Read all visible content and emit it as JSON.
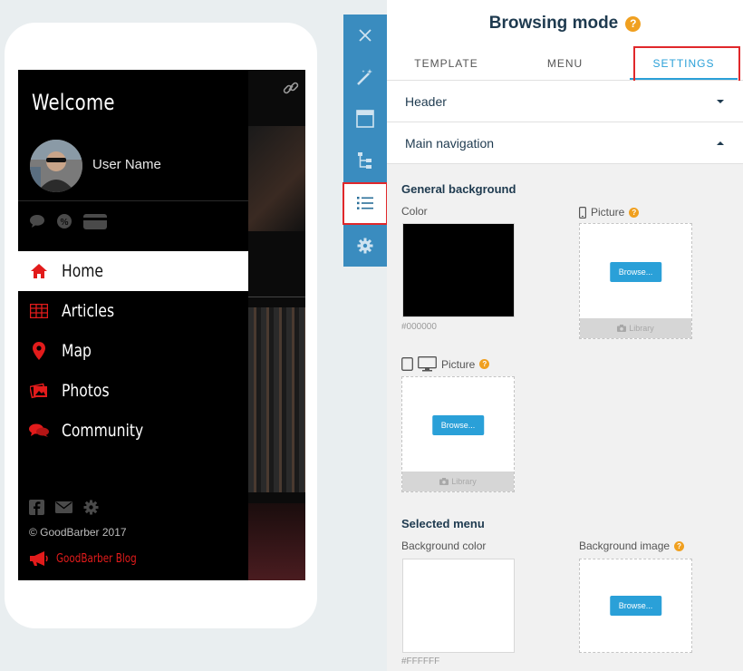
{
  "preview": {
    "welcome": "Welcome",
    "user_name": "User Name",
    "menu": [
      {
        "label": "Home",
        "icon": "home-icon",
        "active": true
      },
      {
        "label": "Articles",
        "icon": "articles-grid-icon"
      },
      {
        "label": "Map",
        "icon": "map-pin-icon"
      },
      {
        "label": "Photos",
        "icon": "photos-icon"
      },
      {
        "label": "Community",
        "icon": "community-chat-icon"
      }
    ],
    "copyright": "© GoodBarber 2017",
    "blog_label": "GoodBarber Blog",
    "accent_color": "#e21b1b"
  },
  "toolbar": {
    "buttons": [
      "close-icon",
      "magic-wand-icon",
      "header-layout-icon",
      "tree-icon",
      "list-menu-icon",
      "gear-icon"
    ],
    "active": "list-menu-icon"
  },
  "panel": {
    "title": "Browsing mode",
    "help": "?",
    "tabs": [
      {
        "label": "TEMPLATE",
        "active": false
      },
      {
        "label": "MENU",
        "active": false
      },
      {
        "label": "SETTINGS",
        "active": true
      }
    ],
    "accordions": [
      {
        "label": "Header",
        "expanded": false
      },
      {
        "label": "Main navigation",
        "expanded": true
      }
    ],
    "general_background": {
      "title": "General background",
      "color_label": "Color",
      "color_value": "#000000",
      "picture_label_phone": "Picture",
      "picture_label_tablet": "Picture",
      "browse": "Browse...",
      "library": "Library"
    },
    "selected_menu": {
      "title": "Selected menu",
      "bg_color_label": "Background color",
      "bg_color_value": "#FFFFFF",
      "bg_image_label": "Background image",
      "browse": "Browse..."
    },
    "accent_color": "#2aa0d8"
  }
}
